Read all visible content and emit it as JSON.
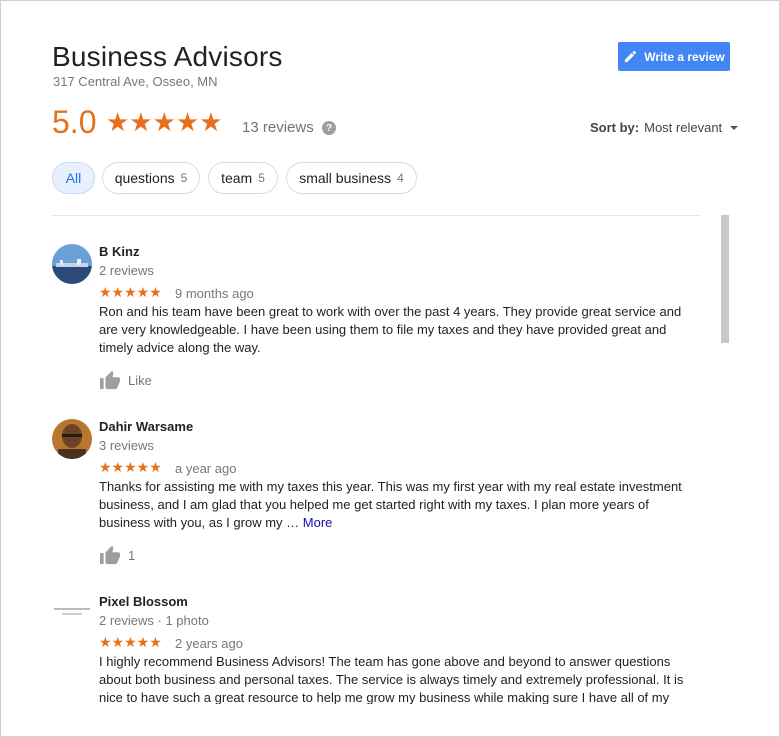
{
  "business": {
    "name": "Business Advisors",
    "address": "317 Central Ave, Osseo, MN",
    "rating": "5.0",
    "stars": "★★★★★",
    "review_count": "13 reviews",
    "help": "?"
  },
  "actions": {
    "write_review": "Write a review"
  },
  "sort": {
    "label": "Sort by:",
    "value": "Most relevant"
  },
  "chips": [
    {
      "label": "All",
      "count": ""
    },
    {
      "label": "questions",
      "count": "5"
    },
    {
      "label": "team",
      "count": "5"
    },
    {
      "label": "small business",
      "count": "4"
    }
  ],
  "reviews": [
    {
      "name": "B Kinz",
      "meta": "2 reviews",
      "stars": "★★★★★",
      "time": "9 months ago",
      "text": "Ron and his team have been great to work with over the past 4 years.  They provide great service and are very knowledgeable.  I have been using them to file my taxes and they have provided great and timely advice along the way.",
      "more": "",
      "like_label": "Like"
    },
    {
      "name": "Dahir Warsame",
      "meta": "3 reviews",
      "stars": "★★★★★",
      "time": "a year ago",
      "text": "Thanks for assisting me with my taxes this year. This was my first year with my real estate investment business, and  I am glad that you helped me get started right with my taxes. I plan more years of business with you, as I grow my …",
      "more": "More",
      "like_label": "1"
    },
    {
      "name": "Pixel Blossom",
      "meta": "2 reviews · 1 photo",
      "stars": "★★★★★",
      "time": "2 years ago",
      "text": "I highly recommend Business Advisors! The team has gone above and beyond to answer questions about both business and personal taxes. The service is always timely and extremely professional. It is nice to have such a great resource to help me grow my business while making sure I have all of my",
      "more": "",
      "like_label": ""
    }
  ],
  "colors": {
    "accent": "#e7711b",
    "button": "#4285f4",
    "link": "#1a0dab"
  }
}
